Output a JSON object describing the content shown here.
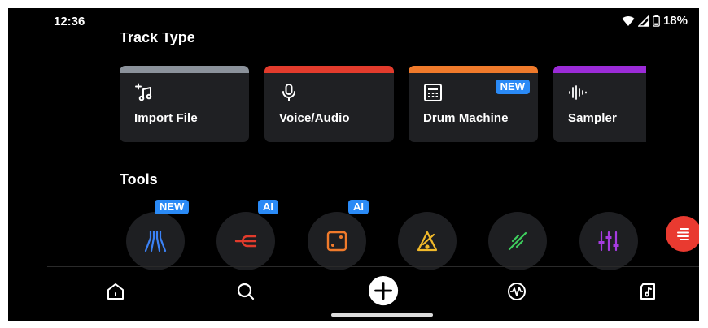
{
  "status": {
    "time": "12:36",
    "battery": "18%"
  },
  "track_type": {
    "title": "Track Type",
    "cards": [
      {
        "label": "Import File",
        "color": "#8b929b",
        "icon": "import-file-icon"
      },
      {
        "label": "Voice/Audio",
        "color": "#e23b2c",
        "icon": "microphone-icon"
      },
      {
        "label": "Drum Machine",
        "color": "#f07a2b",
        "icon": "drum-machine-icon",
        "badge": "NEW"
      },
      {
        "label": "Sampler",
        "color": "#9b2bd8",
        "icon": "sampler-icon"
      }
    ]
  },
  "tools": {
    "title": "Tools",
    "items": [
      {
        "name": "splitter",
        "icon": "stem-splitter-icon",
        "color": "#3b82f6",
        "badge": "NEW"
      },
      {
        "name": "fork",
        "icon": "fork-icon",
        "color": "#e23b2c",
        "badge": "AI"
      },
      {
        "name": "dice",
        "icon": "dice-icon",
        "color": "#f07a2b",
        "badge": "AI"
      },
      {
        "name": "metronome",
        "icon": "metronome-icon",
        "color": "#f1b92a"
      },
      {
        "name": "tuner",
        "icon": "tuner-icon",
        "color": "#3ecf5e"
      },
      {
        "name": "mixer",
        "icon": "mixer-icon",
        "color": "#a63be0"
      }
    ]
  },
  "nav": [
    "home-icon",
    "search-icon",
    "add-icon",
    "pulse-icon",
    "library-icon"
  ]
}
